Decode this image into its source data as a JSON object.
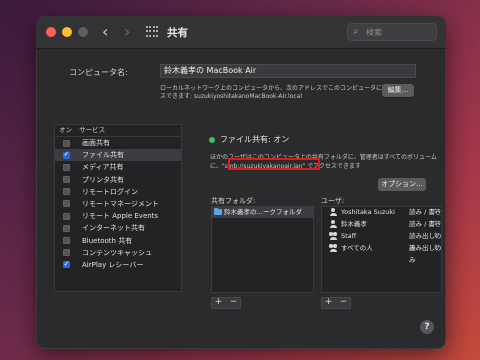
{
  "window": {
    "title": "共有",
    "search_placeholder": "検索"
  },
  "computer_name": {
    "label": "コンピュータ名:",
    "value": "鈴木義孝の MacBook Air",
    "description_line1": "ローカルネットワーク上のコンピュータから、次のアドレスでこのコンピュータにアクセ",
    "description_line2": "スできます: suzukiyoshitakanoMacBook-Air.local",
    "edit_button": "編集..."
  },
  "services": {
    "header_on": "オン",
    "header_service": "サービス",
    "items": [
      {
        "label": "画面共有",
        "checked": false,
        "selected": false
      },
      {
        "label": "ファイル共有",
        "checked": true,
        "selected": true
      },
      {
        "label": "メディア共有",
        "checked": false,
        "selected": false
      },
      {
        "label": "プリンタ共有",
        "checked": false,
        "selected": false
      },
      {
        "label": "リモートログイン",
        "checked": false,
        "selected": false
      },
      {
        "label": "リモートマネージメント",
        "checked": false,
        "selected": false
      },
      {
        "label": "リモート Apple Events",
        "checked": false,
        "selected": false
      },
      {
        "label": "インターネット共有",
        "checked": false,
        "selected": false
      },
      {
        "label": "Bluetooth 共有",
        "checked": false,
        "selected": false
      },
      {
        "label": "コンテンツキャッシュ",
        "checked": false,
        "selected": false
      },
      {
        "label": "AirPlay レシーバー",
        "checked": true,
        "selected": false
      }
    ]
  },
  "file_sharing": {
    "status": "ファイル共有: オン",
    "status_color": "#3ec456",
    "info_line1": "ほかのユーザはこのコンピュータ上の共有フォルダに、管理者はすべてのボリューム",
    "info_prefix": "に、",
    "smb_address": "\"smb://suzukiyakanoair.lan\"",
    "info_suffix": " でアクセスできます",
    "options_button": "オプション...",
    "highlight_color": "#e01b1b"
  },
  "shared_folders": {
    "label": "共有フォルダ:",
    "items": [
      "鈴木義孝の…ークフォルダ"
    ]
  },
  "users": {
    "label": "ユーザ:",
    "items": [
      {
        "name": "Yoshitaka Suzuki",
        "permission": "読み / 書き",
        "icon": "user-icon"
      },
      {
        "name": "鈴木義孝",
        "permission": "読み / 書き",
        "icon": "user-icon"
      },
      {
        "name": "Staff",
        "permission": "読み出しのみ",
        "icon": "group-icon"
      },
      {
        "name": "すべての人",
        "permission": "読み出しのみ",
        "icon": "group-icon"
      }
    ]
  },
  "controls": {
    "add": "+",
    "remove": "−",
    "help": "?"
  }
}
